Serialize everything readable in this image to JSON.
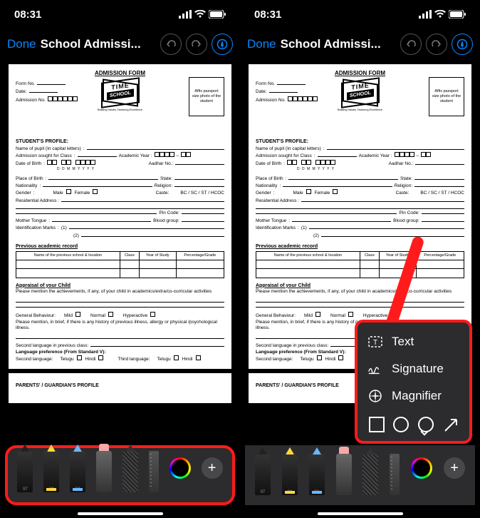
{
  "status": {
    "time": "08:31"
  },
  "header": {
    "done": "Done",
    "title": "School Admissi..."
  },
  "doc": {
    "heading": "ADMISSION FORM",
    "form_no": "Form No.",
    "date": "Date:",
    "admission_no": "Admission No.",
    "photo": "Affix passport size photo of the student",
    "logo_top": "TIME",
    "logo_bottom": "SCHOOL",
    "logo_tag": "Building Values, Nurturing Excellence",
    "profile": "STUDENT'S PROFILE:",
    "name": "Name of pupil (In capital letters)",
    "adm_class": "Admission sought for Class",
    "academic_year": "Academic Year :",
    "dob": "Date of Birth",
    "dob_fmt": "D  D    M  M    Y  Y  Y  Y",
    "aadhar": "Aadhar No.:",
    "place": "Place of Birth",
    "state": "State:",
    "nationality": "Nationality",
    "religion": "Religion:",
    "gender": "Gender",
    "male": "Male",
    "female": "Female",
    "caste": "Caste:",
    "caste_opts": "BC / SC / ST / HCOC",
    "res_addr": "Residential Address :",
    "pincode": "Pin Code:",
    "mother_tongue": "Mother Tongue",
    "blood_group": "Blood group:",
    "id_marks": "Identification Marks",
    "prev_record": "Previous academic record",
    "col1": "Name of the previous school & location",
    "col2": "Class",
    "col3": "Year of Study",
    "col4": "Percentage/Grade",
    "appraisal": "Appraisal of your Child",
    "appraisal_sub": "Please mention the achievements, if any, of your child in academics/extra/co-curricular activities",
    "behaviour": "General Behaviour:",
    "mild": "Mild",
    "normal": "Normal",
    "hyper": "Hyperactive",
    "illness": "Please mention, in brief, if there is any history of previous illness, allergy or physical /psychological illness.",
    "second_lang_prev": "Second language in previous class:",
    "lang_pref": "Language preference (From Standard V):",
    "second_lang": "Second language:",
    "third_lang": "Third language:",
    "telugu": "Telugu",
    "hindi": "Hindi",
    "parents": "PARENTS' / GUARDIAN'S PROFILE"
  },
  "popup": {
    "text": "Text",
    "signature": "Signature",
    "magnifier": "Magnifier"
  },
  "tools": {
    "n1": "97",
    "n2": "80",
    "n3": "50"
  }
}
